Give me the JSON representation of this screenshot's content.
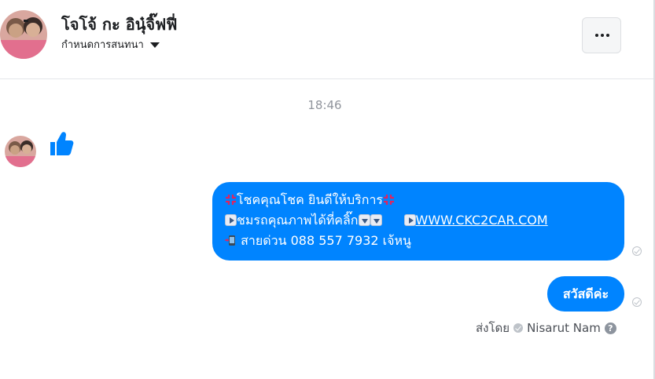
{
  "header": {
    "contact_name": "โจโจ้ กะ อินุ๋จิ๊ฟฟี่",
    "settings_label": "กำหนดการสนทนา",
    "more_icon": "more-icon"
  },
  "chat": {
    "timestamp": "18:46",
    "received": {
      "sticker": "thumbs-up-icon"
    },
    "sent": [
      {
        "line1": "โชคคุณโชค ยินดีให้บริการ",
        "line2_text": "ชมรถคุณภาพได้ที่คลิ๊ก",
        "link": "WWW.CKC2CAR.COM",
        "line3": " สายด่วน 088 557 7932 เจ้หนู"
      },
      {
        "text": "สวัสดีค่ะ"
      }
    ],
    "sent_by_label": "ส่งโดย",
    "sender_name": "Nisarut Nam",
    "help_icon": "?"
  },
  "colors": {
    "bubble": "#0084ff",
    "timestamp": "#90949c",
    "thumb": "#0084ff"
  }
}
